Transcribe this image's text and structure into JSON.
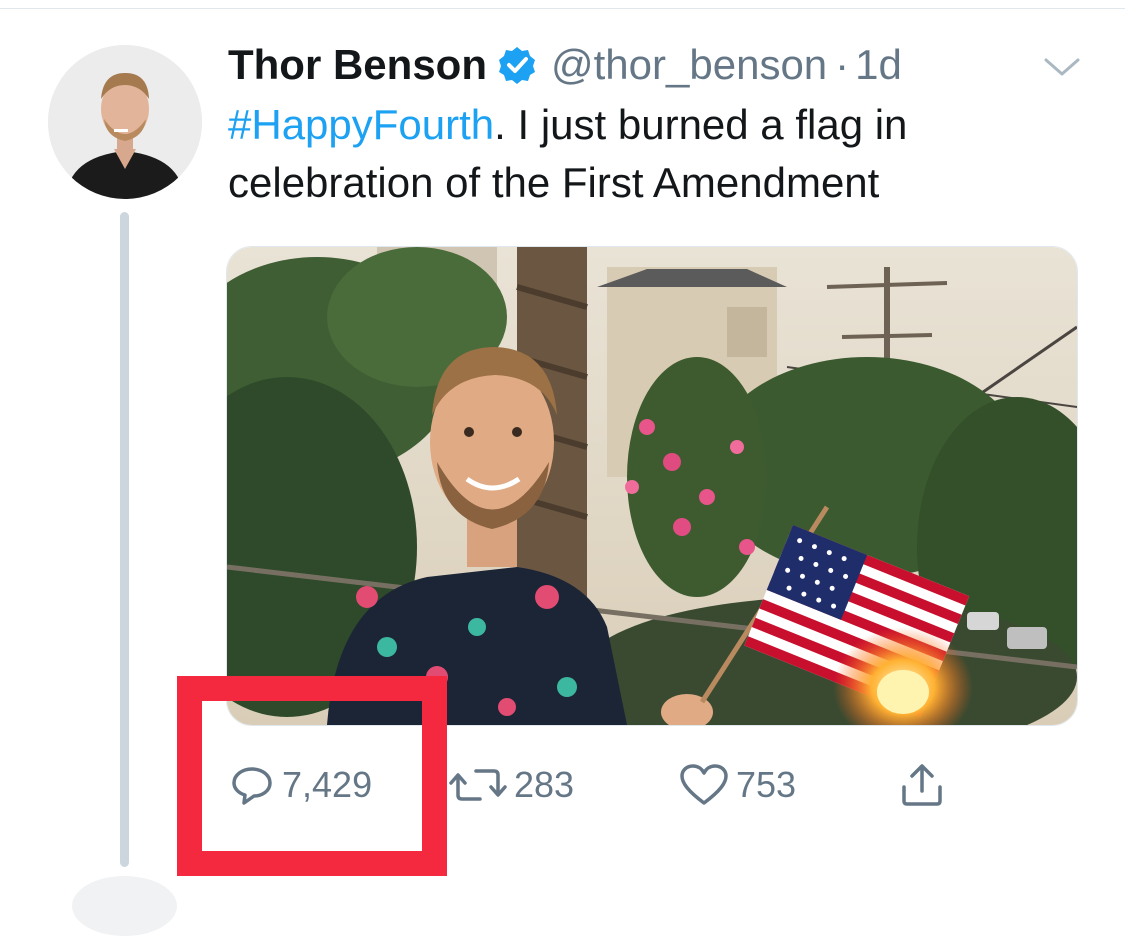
{
  "tweet": {
    "author_name": "Thor Benson",
    "handle": "@thor_benson",
    "separator": "·",
    "time": "1d",
    "hashtag": "#HappyFourth",
    "text_rest": ". I just burned a flag in celebration of the First Amendment"
  },
  "actions": {
    "replies": "7,429",
    "retweets": "283",
    "likes": "753"
  },
  "colors": {
    "link_blue": "#1da1f2",
    "muted_gray": "#657786",
    "highlight_red": "#f4293f"
  },
  "icons": [
    "verified-badge-icon",
    "chevron-down-icon",
    "reply-icon",
    "retweet-icon",
    "like-icon",
    "share-icon"
  ]
}
